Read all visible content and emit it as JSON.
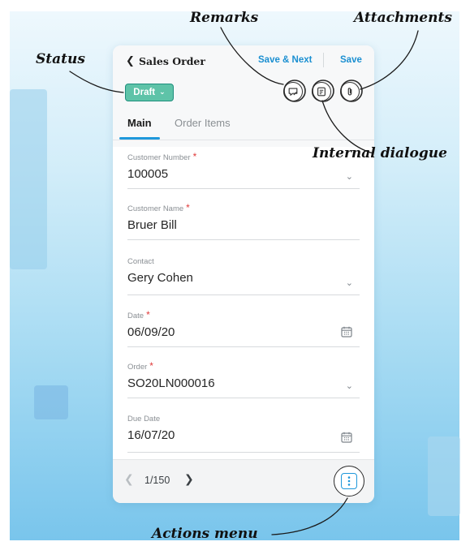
{
  "header": {
    "back_icon": "chevron-left-icon",
    "title": "Sales Order",
    "save_next_label": "Save & Next",
    "save_label": "Save"
  },
  "status": {
    "label": "Draft",
    "color": "#5ec3a8"
  },
  "header_icons": [
    "remarks-icon",
    "internal-dialogue-icon",
    "attachment-icon"
  ],
  "tabs": [
    {
      "label": "Main",
      "active": true
    },
    {
      "label": "Order Items",
      "active": false
    }
  ],
  "fields": [
    {
      "label": "Customer Number",
      "required": true,
      "value": "100005",
      "trailing": "chevron-down-icon"
    },
    {
      "label": "Customer Name",
      "required": true,
      "value": "Bruer Bill",
      "trailing": ""
    },
    {
      "label": "Contact",
      "required": false,
      "value": "Gery Cohen",
      "trailing": "chevron-down-icon"
    },
    {
      "label": "Date",
      "required": true,
      "value": "06/09/20",
      "trailing": "calendar-icon"
    },
    {
      "label": "Order",
      "required": true,
      "value": "SO20LN000016",
      "trailing": "chevron-down-icon"
    },
    {
      "label": "Due Date",
      "required": false,
      "value": "16/07/20",
      "trailing": "calendar-icon"
    }
  ],
  "required_marker": "*",
  "pagination": {
    "text": "1/150",
    "prev_icon": "chevron-left-icon",
    "next_icon": "chevron-right-icon"
  },
  "actions": {
    "icon": "more-vertical-icon"
  },
  "callouts": {
    "remarks": "Remarks",
    "attachments": "Attachments",
    "status": "Status",
    "internal_dialogue": "Internal dialogue",
    "actions_menu": "Actions menu"
  },
  "colors": {
    "accent": "#1f98db",
    "required": "#e03a3a"
  }
}
